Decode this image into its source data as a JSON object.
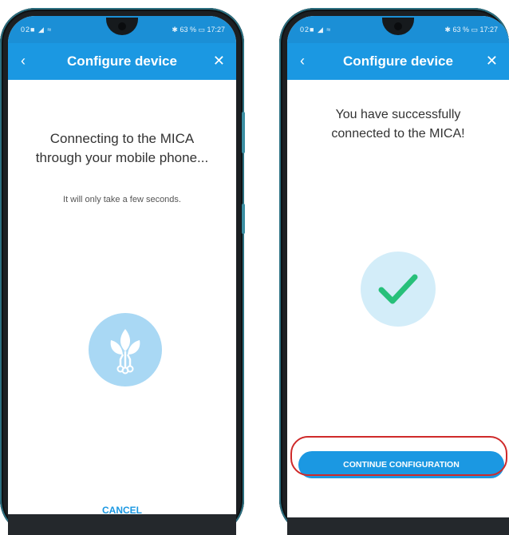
{
  "left_screen": {
    "status_left": "02■ ◢ ≈",
    "status_right": "✱ 63 % ▭ 17:27",
    "title": "Configure device",
    "message_line1": "Connecting to the MICA",
    "message_line2": "through your mobile phone...",
    "submessage": "It will only take a few seconds.",
    "cancel_label": "CANCEL"
  },
  "right_screen": {
    "status_left": "02■ ◢ ≈",
    "status_right": "✱ 63 % ▭ 17:27",
    "title": "Configure device",
    "message_line1": "You have successfully",
    "message_line2": "connected to the MICA!",
    "continue_label": "CONTINUE CONFIGURATION"
  },
  "icons": {
    "back": "chevron-left-icon",
    "close": "close-icon",
    "plant": "plant-circuit-icon",
    "success": "checkmark-icon"
  },
  "colors": {
    "primary": "#1b98e2",
    "check_green": "#27c07a",
    "highlight_red": "#cf2a2a"
  }
}
